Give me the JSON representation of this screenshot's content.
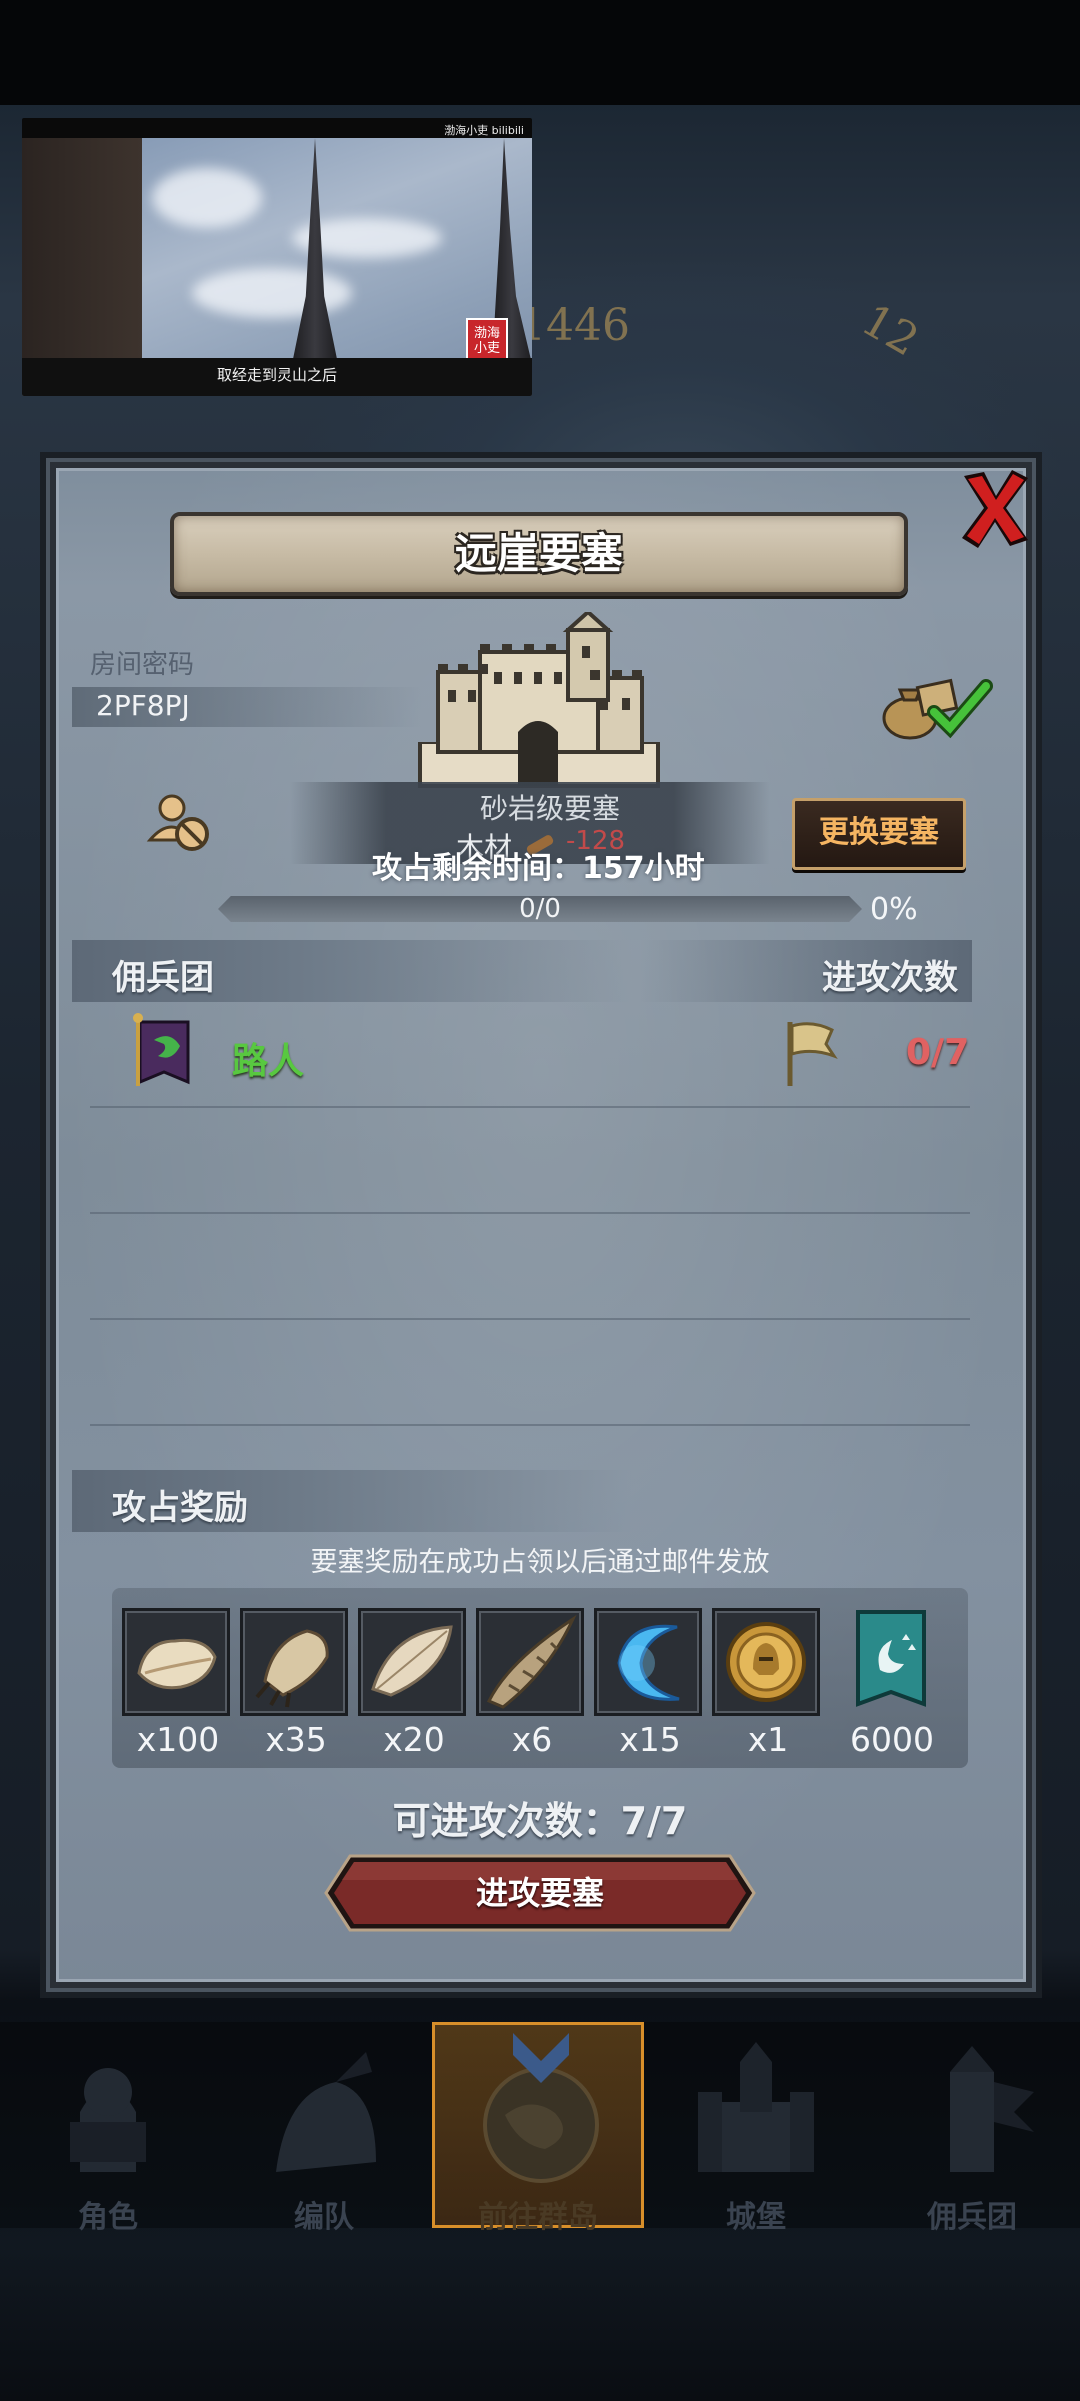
{
  "video_overlay": {
    "watermark": "渤海小吏 bilibili",
    "seal_text": "渤海小吏",
    "subtitle": "取经走到灵山之后"
  },
  "background": {
    "clock_year": "1446",
    "clock_hour": "12"
  },
  "dialog": {
    "title": "远崖要塞",
    "room_password_label": "房间密码",
    "room_password": "2PF8PJ",
    "fortress_level": "砂岩级要塞",
    "wood_label": "木材",
    "wood_value": "-128",
    "time_remaining": "攻占剩余时间：157小时",
    "change_button": "更换要塞",
    "progress": {
      "text": "0/0",
      "percent_text": "0%",
      "fraction": 0
    },
    "mercenary_header": "佣兵团",
    "attempts_header": "进攻次数",
    "members": [
      {
        "name": "路人",
        "attempts": "0/7"
      }
    ],
    "rewards_header": "攻占奖励",
    "rewards_note": "要塞奖励在成功占领以后通过邮件发放",
    "rewards": [
      {
        "icon": "fur-pelt-icon",
        "qty": "x100"
      },
      {
        "icon": "claw-icon",
        "qty": "x35"
      },
      {
        "icon": "feather-icon",
        "qty": "x20"
      },
      {
        "icon": "horn-icon",
        "qty": "x6"
      },
      {
        "icon": "blue-crescent-icon",
        "qty": "x15"
      },
      {
        "icon": "gold-medal-icon",
        "qty": "x1"
      },
      {
        "icon": "banner-icon",
        "qty": "6000"
      }
    ],
    "available_attempts": "可进攻次数：7/7",
    "attack_button": "进攻要塞"
  },
  "bottom_nav": [
    {
      "label": "角色"
    },
    {
      "label": "编队"
    },
    {
      "label": "前往群岛",
      "active": true
    },
    {
      "label": "城堡"
    },
    {
      "label": "佣兵团"
    }
  ],
  "colors": {
    "accent_orange": "#f5b562",
    "member_green": "#58c840",
    "attempt_red": "#e06262",
    "panel_gray": "#8391a0"
  }
}
